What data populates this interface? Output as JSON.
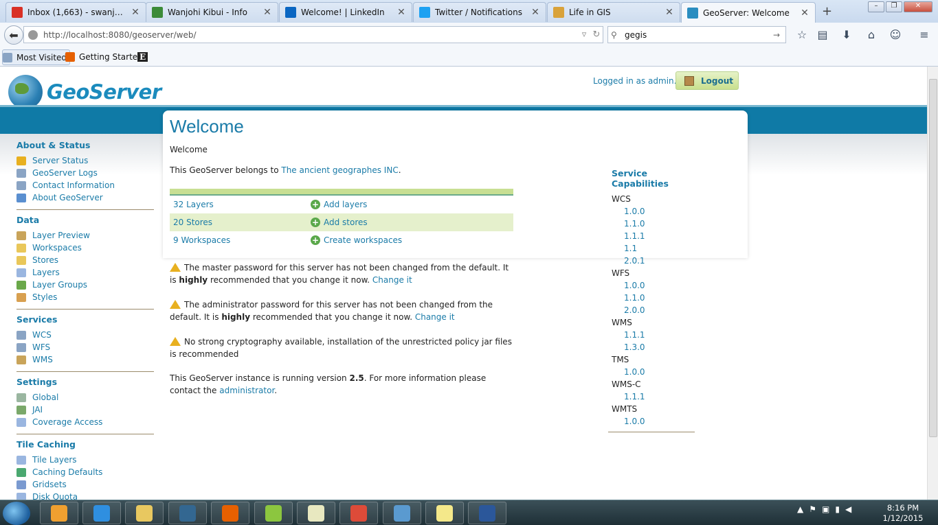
{
  "browser": {
    "tabs": [
      {
        "label": "Inbox (1,663) - swanjohi...",
        "icon": "gmail-icon",
        "color": "#d93025",
        "active": false
      },
      {
        "label": "Wanjohi Kibui - Info",
        "icon": "researchgate-icon",
        "color": "#3c8b38",
        "active": false
      },
      {
        "label": "Welcome! | LinkedIn",
        "icon": "linkedin-icon",
        "color": "#0a66c2",
        "active": false
      },
      {
        "label": "Twitter / Notifications",
        "icon": "twitter-icon",
        "color": "#1da1f2",
        "active": false
      },
      {
        "label": "Life in GIS",
        "icon": "blog-icon",
        "color": "#d9a23a",
        "active": false
      },
      {
        "label": "GeoServer: Welcome",
        "icon": "geoserver-icon",
        "color": "#2a8dc0",
        "active": true
      }
    ],
    "url": "http://localhost:8080/geoserver/web/",
    "search_value": "gegis",
    "bookmarks": [
      {
        "label": "Most Visited",
        "icon": "bookmark-folder-icon"
      },
      {
        "label": "Getting Started",
        "icon": "firefox-icon"
      },
      {
        "label": "E",
        "icon": "e-bookmark-icon"
      }
    ]
  },
  "header": {
    "app_name": "GeoServer",
    "logged_in_text": "Logged in as admin.",
    "logout_label": "Logout"
  },
  "sidebar": {
    "sections": [
      {
        "title": "About & Status",
        "items": [
          {
            "label": "Server Status",
            "icon": "warning-icon",
            "color": "#e8b020"
          },
          {
            "label": "GeoServer Logs",
            "icon": "logs-icon",
            "color": "#8aa4c4"
          },
          {
            "label": "Contact Information",
            "icon": "contact-icon",
            "color": "#8aa4c4"
          },
          {
            "label": "About GeoServer",
            "icon": "info-icon",
            "color": "#5a8fd0"
          }
        ]
      },
      {
        "title": "Data",
        "items": [
          {
            "label": "Layer Preview",
            "icon": "layer-preview-icon",
            "color": "#c9a45a"
          },
          {
            "label": "Workspaces",
            "icon": "folder-icon",
            "color": "#e9c75a"
          },
          {
            "label": "Stores",
            "icon": "store-icon",
            "color": "#e9c75a"
          },
          {
            "label": "Layers",
            "icon": "layers-icon",
            "color": "#9ab6e0"
          },
          {
            "label": "Layer Groups",
            "icon": "layer-groups-icon",
            "color": "#6aa84a"
          },
          {
            "label": "Styles",
            "icon": "palette-icon",
            "color": "#d8a050"
          }
        ]
      },
      {
        "title": "Services",
        "items": [
          {
            "label": "WCS",
            "icon": "wcs-icon",
            "color": "#8aa4c4"
          },
          {
            "label": "WFS",
            "icon": "wfs-icon",
            "color": "#8aa4c4"
          },
          {
            "label": "WMS",
            "icon": "wms-icon",
            "color": "#c9a45a"
          }
        ]
      },
      {
        "title": "Settings",
        "items": [
          {
            "label": "Global",
            "icon": "global-settings-icon",
            "color": "#9ab6a0"
          },
          {
            "label": "JAI",
            "icon": "jai-icon",
            "color": "#7aa86a"
          },
          {
            "label": "Coverage Access",
            "icon": "coverage-icon",
            "color": "#9ab6e0"
          }
        ]
      },
      {
        "title": "Tile Caching",
        "items": [
          {
            "label": "Tile Layers",
            "icon": "tile-layers-icon",
            "color": "#9ab6e0"
          },
          {
            "label": "Caching Defaults",
            "icon": "globe-icon",
            "color": "#4aa870"
          },
          {
            "label": "Gridsets",
            "icon": "grid-icon",
            "color": "#7a9ad0"
          },
          {
            "label": "Disk Quota",
            "icon": "disk-icon",
            "color": "#9ab6e0"
          }
        ]
      }
    ]
  },
  "main": {
    "title": "Welcome",
    "subtitle": "Welcome",
    "belongs_prefix": "This GeoServer belongs to ",
    "belongs_org": "The ancient geographes INC",
    "belongs_suffix": ".",
    "summary": [
      {
        "count": "32 Layers",
        "action": "Add layers"
      },
      {
        "count": "20 Stores",
        "action": "Add stores"
      },
      {
        "count": "9 Workspaces",
        "action": "Create workspaces"
      }
    ],
    "warnings": [
      {
        "text1": "The master password for this server has not been changed from the default. It is ",
        "strong": "highly",
        "text2": " recommended that you change it now. ",
        "link": "Change it"
      },
      {
        "text1": "The administrator password for this server has not been changed from the default. It is ",
        "strong": "highly",
        "text2": " recommended that you change it now. ",
        "link": "Change it"
      },
      {
        "text1": "No strong cryptography available, installation of the unrestricted policy jar files is recommended",
        "strong": "",
        "text2": "",
        "link": ""
      }
    ],
    "version_prefix": "This GeoServer instance is running version ",
    "version": "2.5",
    "version_suffix": ". For more information please contact the ",
    "admin_link": "administrator",
    "version_end": "."
  },
  "capabilities": {
    "title": "Service Capabilities",
    "services": [
      {
        "name": "WCS",
        "versions": [
          "1.0.0",
          "1.1.0",
          "1.1.1",
          "1.1",
          "2.0.1"
        ]
      },
      {
        "name": "WFS",
        "versions": [
          "1.0.0",
          "1.1.0",
          "2.0.0"
        ]
      },
      {
        "name": "WMS",
        "versions": [
          "1.1.1",
          "1.3.0"
        ]
      },
      {
        "name": "TMS",
        "versions": [
          "1.0.0"
        ]
      },
      {
        "name": "WMS-C",
        "versions": [
          "1.1.1"
        ]
      },
      {
        "name": "WMTS",
        "versions": [
          "1.0.0"
        ]
      }
    ]
  },
  "taskbar": {
    "apps": [
      {
        "name": "media-player-icon",
        "color": "#f0a030"
      },
      {
        "name": "internet-explorer-icon",
        "color": "#2f8fe0"
      },
      {
        "name": "file-explorer-icon",
        "color": "#e8c860"
      },
      {
        "name": "pgadmin-icon",
        "color": "#336791"
      },
      {
        "name": "firefox-icon",
        "color": "#e66000"
      },
      {
        "name": "qgis-icon",
        "color": "#8cc63f"
      },
      {
        "name": "spreadsheet-icon",
        "color": "#e8e8c0"
      },
      {
        "name": "chrome-icon",
        "color": "#dd4b39"
      },
      {
        "name": "globe-app-icon",
        "color": "#5a9ad0"
      },
      {
        "name": "sticky-notes-icon",
        "color": "#f4e88a"
      },
      {
        "name": "word-icon",
        "color": "#2b579a"
      }
    ],
    "time": "8:16 PM",
    "date": "1/12/2015"
  }
}
